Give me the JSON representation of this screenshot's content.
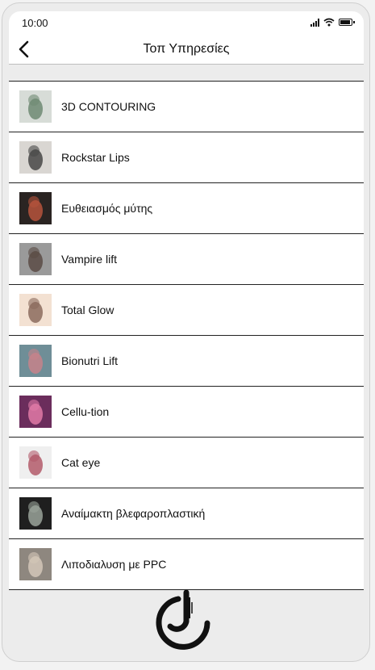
{
  "status": {
    "time": "10:00"
  },
  "header": {
    "title": "Τοπ Υπηρεσίες",
    "back_icon": "chevron-left-icon"
  },
  "services": [
    {
      "label": "3D CONTOURING",
      "thumb_bg": "#d7dcd7",
      "thumb_fg": "#6f8a73"
    },
    {
      "label": "Rockstar Lips",
      "thumb_bg": "#d9d6d2",
      "thumb_fg": "#474747"
    },
    {
      "label": "Ευθειασμός μύτης",
      "thumb_bg": "#2a2422",
      "thumb_fg": "#b6543c"
    },
    {
      "label": "Vampire lift",
      "thumb_bg": "#9a9a9a",
      "thumb_fg": "#5a4b45"
    },
    {
      "label": "Total Glow",
      "thumb_bg": "#f3e1d2",
      "thumb_fg": "#8b6b5e"
    },
    {
      "label": "Bionutri Lift",
      "thumb_bg": "#6f8e97",
      "thumb_fg": "#c7828a"
    },
    {
      "label": "Cellu-tion",
      "thumb_bg": "#6b2d5c",
      "thumb_fg": "#e07aa6"
    },
    {
      "label": "Cat eye",
      "thumb_bg": "#efefef",
      "thumb_fg": "#b35a6a"
    },
    {
      "label": "Αναίμακτη βλεφαροπλαστική",
      "thumb_bg": "#1f1f1f",
      "thumb_fg": "#9aa39a"
    },
    {
      "label": "Λιποδιαλυση με PPC",
      "thumb_bg": "#8e877f",
      "thumb_fg": "#d4c7b8"
    }
  ],
  "logo": {
    "icon": "brand-logo-icon"
  }
}
